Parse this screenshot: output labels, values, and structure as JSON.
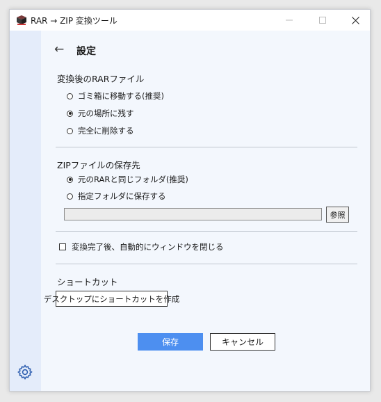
{
  "window": {
    "title": "RAR → ZIP 変換ツール",
    "app_icon": "box-icon",
    "controls": [
      "minimize-icon",
      "maximize-icon",
      "close-icon"
    ]
  },
  "sidebar": {
    "icon": "gear-icon"
  },
  "header": {
    "back_glyph": "←",
    "title": "設定"
  },
  "rar_section": {
    "label": "変換後のRARファイル",
    "options": [
      {
        "label": "ゴミ箱に移動する(推奨)",
        "selected": false
      },
      {
        "label": "元の場所に残す",
        "selected": true
      },
      {
        "label": "完全に削除する",
        "selected": false
      }
    ]
  },
  "zip_section": {
    "label": "ZIPファイルの保存先",
    "options": [
      {
        "label": "元のRARと同じフォルダ(推奨)",
        "selected": true
      },
      {
        "label": "指定フォルダに保存する",
        "selected": false
      }
    ],
    "path_value": "",
    "browse_label": "参照"
  },
  "auto_close": {
    "label": "変換完了後、自動的にウィンドウを閉じる",
    "checked": false
  },
  "shortcut_section": {
    "label": "ショートカット",
    "button_label": "デスクトップにショートカットを作成"
  },
  "footer": {
    "save_label": "保存",
    "cancel_label": "キャンセル"
  },
  "colors": {
    "accent": "#4d8ff0",
    "sidebar": "#e4ecfa",
    "content_bg": "#f3f7fd"
  }
}
